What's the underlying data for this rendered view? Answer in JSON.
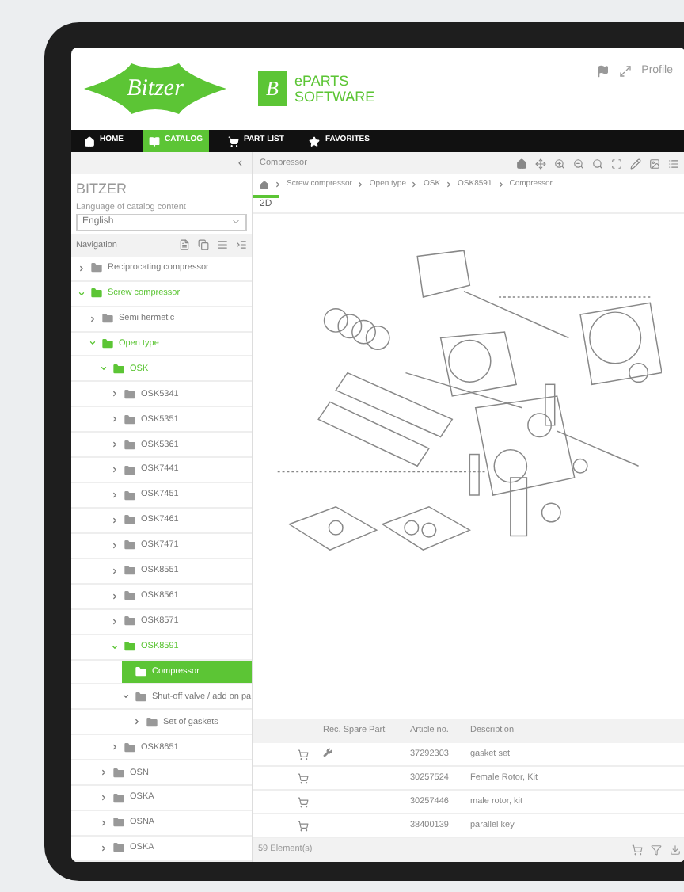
{
  "header": {
    "logo_text": "Bitzer",
    "app_logo_letter": "B",
    "app_name": [
      "ePARTS",
      "SOFTWARE"
    ],
    "profile": "Profile"
  },
  "nav": [
    {
      "label": "HOME",
      "selected": false
    },
    {
      "label": "CATALOG",
      "selected": true
    },
    {
      "label": "PART LIST",
      "selected": false
    },
    {
      "label": "FAVORITES",
      "selected": false
    }
  ],
  "sidebar": {
    "collapse": "‹",
    "title": "BITZER",
    "language_label": "Language of catalog content",
    "language": "English",
    "navigation_label": "Navigation",
    "tree": [
      {
        "label": "Reciprocating compressor",
        "expanded": false,
        "selected": false
      },
      {
        "label": "Screw compressor",
        "expanded": true,
        "selected": false,
        "children": [
          {
            "label": "Semi hermetic",
            "expanded": false,
            "selected": false
          },
          {
            "label": "Open type",
            "expanded": true,
            "selected": false,
            "children": [
              {
                "label": "OSK",
                "expanded": true,
                "selected": false,
                "children": [
                  {
                    "label": "OSK5341",
                    "expanded": false,
                    "selected": false
                  },
                  {
                    "label": "OSK5351",
                    "expanded": false,
                    "selected": false
                  },
                  {
                    "label": "OSK5361",
                    "expanded": false,
                    "selected": false
                  },
                  {
                    "label": "OSK7441",
                    "expanded": false,
                    "selected": false
                  },
                  {
                    "label": "OSK7451",
                    "expanded": false,
                    "selected": false
                  },
                  {
                    "label": "OSK7461",
                    "expanded": false,
                    "selected": false
                  },
                  {
                    "label": "OSK7471",
                    "expanded": false,
                    "selected": false
                  },
                  {
                    "label": "OSK8551",
                    "expanded": false,
                    "selected": false
                  },
                  {
                    "label": "OSK8561",
                    "expanded": false,
                    "selected": false
                  },
                  {
                    "label": "OSK8571",
                    "expanded": false,
                    "selected": false
                  },
                  {
                    "label": "OSK8591",
                    "expanded": true,
                    "selected": false,
                    "children": [
                      {
                        "label": "Compressor",
                        "expanded": false,
                        "selected": true
                      },
                      {
                        "label": "Shut-off valve / add on pa",
                        "expanded": true,
                        "selected": false,
                        "children": [
                          {
                            "label": "Set of gaskets",
                            "expanded": false,
                            "selected": false
                          }
                        ]
                      }
                    ]
                  },
                  {
                    "label": "OSK8651",
                    "expanded": false,
                    "selected": false
                  }
                ]
              },
              {
                "label": "OSN",
                "expanded": false,
                "selected": false
              },
              {
                "label": "OSKA",
                "expanded": false,
                "selected": false
              },
              {
                "label": "OSNA",
                "expanded": false,
                "selected": false
              },
              {
                "label": "OSKA",
                "expanded": false,
                "selected": false
              }
            ]
          }
        ]
      }
    ]
  },
  "main": {
    "title": "Compressor",
    "breadcrumb": [
      "Screw compressor",
      "Open type",
      "OSK",
      "OSK8591",
      "Compressor"
    ],
    "tabs": [
      {
        "label": "2D",
        "selected": true
      }
    ],
    "table": {
      "columns": [
        "Rec. Spare Part",
        "Article no.",
        "Description"
      ],
      "rows": [
        {
          "recommended": true,
          "article": "37292303",
          "description": "gasket set"
        },
        {
          "recommended": false,
          "article": "30257524",
          "description": "Female Rotor, Kit"
        },
        {
          "recommended": false,
          "article": "30257446",
          "description": "male rotor, kit"
        },
        {
          "recommended": false,
          "article": "38400139",
          "description": "parallel key"
        }
      ]
    },
    "count": "59 Element(s)"
  }
}
